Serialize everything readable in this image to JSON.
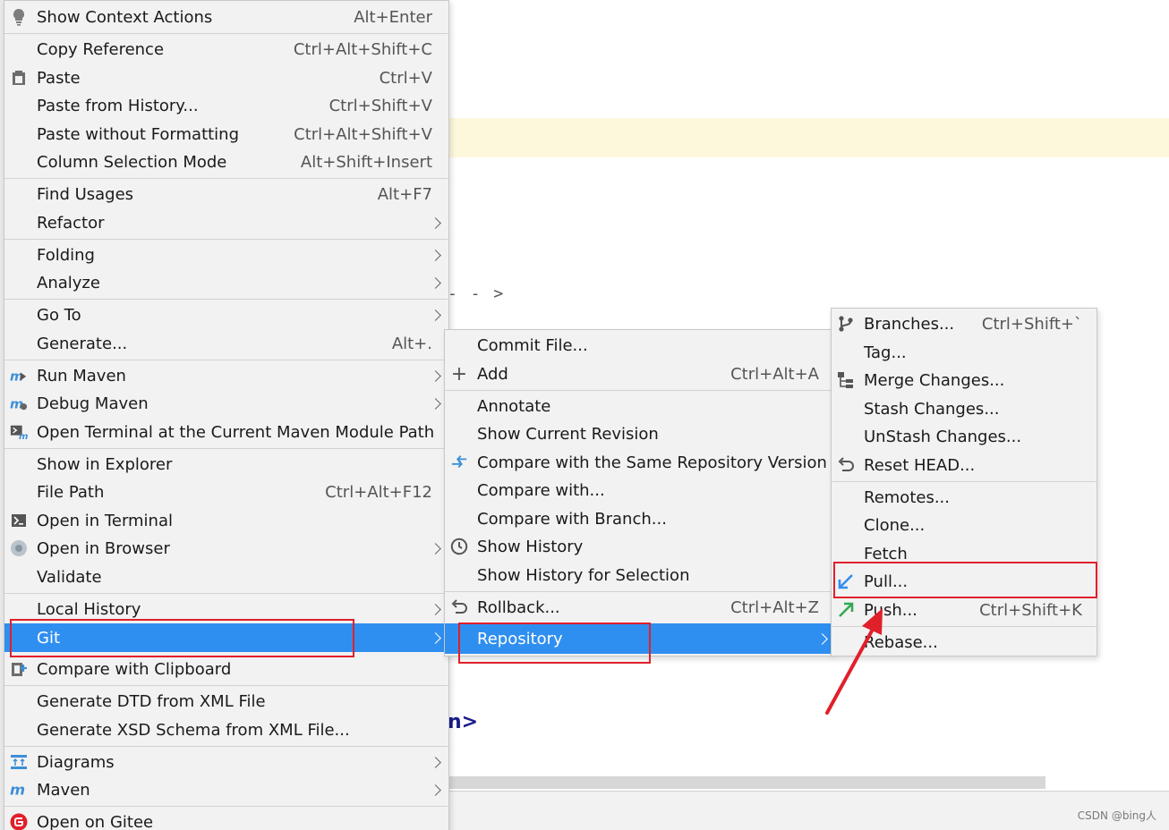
{
  "menu_main": {
    "items": [
      {
        "label": "Show Context Actions",
        "shortcut": "Alt+Enter",
        "icon": "bulb-icon"
      },
      {
        "label": "Copy Reference",
        "shortcut": "Ctrl+Alt+Shift+C"
      },
      {
        "label": "Paste",
        "shortcut": "Ctrl+V",
        "icon": "clipboard-icon"
      },
      {
        "label": "Paste from History...",
        "shortcut": "Ctrl+Shift+V"
      },
      {
        "label": "Paste without Formatting",
        "shortcut": "Ctrl+Alt+Shift+V"
      },
      {
        "label": "Column Selection Mode",
        "shortcut": "Alt+Shift+Insert"
      },
      {
        "label": "Find Usages",
        "shortcut": "Alt+F7"
      },
      {
        "label": "Refactor",
        "submenu": true
      },
      {
        "label": "Folding",
        "submenu": true
      },
      {
        "label": "Analyze",
        "submenu": true
      },
      {
        "label": "Go To",
        "submenu": true
      },
      {
        "label": "Generate...",
        "shortcut": "Alt+."
      },
      {
        "label": "Run Maven",
        "submenu": true,
        "icon": "maven-run-icon"
      },
      {
        "label": "Debug Maven",
        "submenu": true,
        "icon": "maven-debug-icon"
      },
      {
        "label": "Open Terminal at the Current Maven Module Path",
        "icon": "maven-terminal-icon"
      },
      {
        "label": "Show in Explorer"
      },
      {
        "label": "File Path",
        "shortcut": "Ctrl+Alt+F12"
      },
      {
        "label": "Open in Terminal",
        "icon": "terminal-icon"
      },
      {
        "label": "Open in Browser",
        "submenu": true,
        "icon": "globe-icon"
      },
      {
        "label": "Validate"
      },
      {
        "label": "Local History",
        "submenu": true
      },
      {
        "label": "Git",
        "submenu": true,
        "selected": true
      },
      {
        "label": "Compare with Clipboard",
        "icon": "compare-clipboard-icon"
      },
      {
        "label": "Generate DTD from XML File"
      },
      {
        "label": "Generate XSD Schema from XML File..."
      },
      {
        "label": "Diagrams",
        "submenu": true,
        "icon": "diagram-icon"
      },
      {
        "label": "Maven",
        "submenu": true,
        "icon": "maven-icon"
      },
      {
        "label": "Open on Gitee",
        "icon": "gitee-icon"
      }
    ]
  },
  "menu_git": {
    "items": [
      {
        "label": "Commit File..."
      },
      {
        "label": "Add",
        "shortcut": "Ctrl+Alt+A",
        "icon": "plus-icon"
      },
      {
        "label": "Annotate"
      },
      {
        "label": "Show Current Revision"
      },
      {
        "label": "Compare with the Same Repository Version",
        "icon": "compare-arrows-icon"
      },
      {
        "label": "Compare with..."
      },
      {
        "label": "Compare with Branch..."
      },
      {
        "label": "Show History",
        "icon": "clock-icon"
      },
      {
        "label": "Show History for Selection"
      },
      {
        "label": "Rollback...",
        "shortcut": "Ctrl+Alt+Z",
        "icon": "rollback-icon"
      },
      {
        "label": "Repository",
        "submenu": true,
        "selected": true
      }
    ]
  },
  "menu_repository": {
    "items": [
      {
        "label": "Branches...",
        "shortcut": "Ctrl+Shift+`",
        "icon": "branch-icon"
      },
      {
        "label": "Tag..."
      },
      {
        "label": "Merge Changes...",
        "icon": "merge-icon"
      },
      {
        "label": "Stash Changes..."
      },
      {
        "label": "UnStash Changes..."
      },
      {
        "label": "Reset HEAD...",
        "icon": "reset-icon"
      },
      {
        "label": "Remotes..."
      },
      {
        "label": "Clone..."
      },
      {
        "label": "Fetch"
      },
      {
        "label": "Pull...",
        "icon": "pull-arrow-icon"
      },
      {
        "label": "Push...",
        "shortcut": "Ctrl+Shift+K",
        "icon": "push-arrow-icon"
      },
      {
        "label": "Rebase..."
      }
    ]
  },
  "background": {
    "arrow_text": "- - >",
    "tag_fragment": "n>"
  },
  "watermark": "CSDN @bing人",
  "colors": {
    "menu_bg": "#f2f2f2",
    "selection": "#2f8ff0",
    "annotation_red": "#e0202a"
  }
}
